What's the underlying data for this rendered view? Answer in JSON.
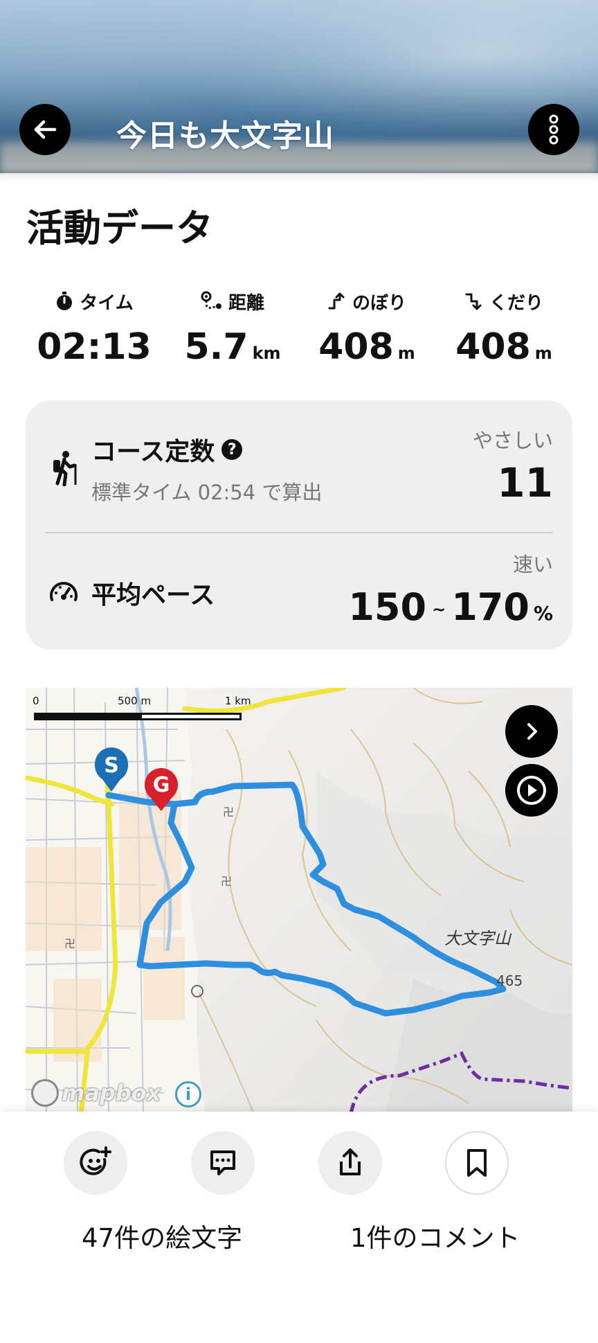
{
  "header": {
    "title": "今日も大文字山"
  },
  "activity": {
    "section_title": "活動データ",
    "stats": [
      {
        "label": "タイム",
        "value": "02:13",
        "unit": ""
      },
      {
        "label": "距離",
        "value": "5.7",
        "unit": "km"
      },
      {
        "label": "のぼり",
        "value": "408",
        "unit": "m"
      },
      {
        "label": "くだり",
        "value": "408",
        "unit": "m"
      }
    ]
  },
  "course": {
    "title": "コース定数",
    "help": "?",
    "subtitle": "標準タイム 02:54 で算出",
    "level": "やさしい",
    "value": "11"
  },
  "pace": {
    "title": "平均ペース",
    "label": "速い",
    "min": "150",
    "tilde": "~",
    "max": "170",
    "unit": "%"
  },
  "map": {
    "scale_labels": [
      "0",
      "500 m",
      "1 km"
    ],
    "start_marker": "S",
    "goal_marker": "G",
    "mountain_label": "大文字山",
    "elevation_label": "465",
    "attribution": "mapbox",
    "info": "i",
    "colors": {
      "route": "#2f8fdf",
      "start": "#1a6fb5",
      "goal": "#d8202a",
      "major_road": "#f0e63a",
      "contour": "#d8c08c",
      "trail": "#6a2ca8"
    }
  },
  "actions": {
    "emoji_count_text": "47件の絵文字",
    "comment_count_text": "1件のコメント"
  },
  "icons": [
    "back-arrow-icon",
    "more-vert-icon",
    "stopwatch-icon",
    "distance-icon",
    "ascent-icon",
    "descent-icon",
    "hiker-icon",
    "help-icon",
    "speedometer-icon",
    "chevron-right-icon",
    "play-icon",
    "add-emoji-icon",
    "comment-icon",
    "share-icon",
    "bookmark-icon"
  ]
}
